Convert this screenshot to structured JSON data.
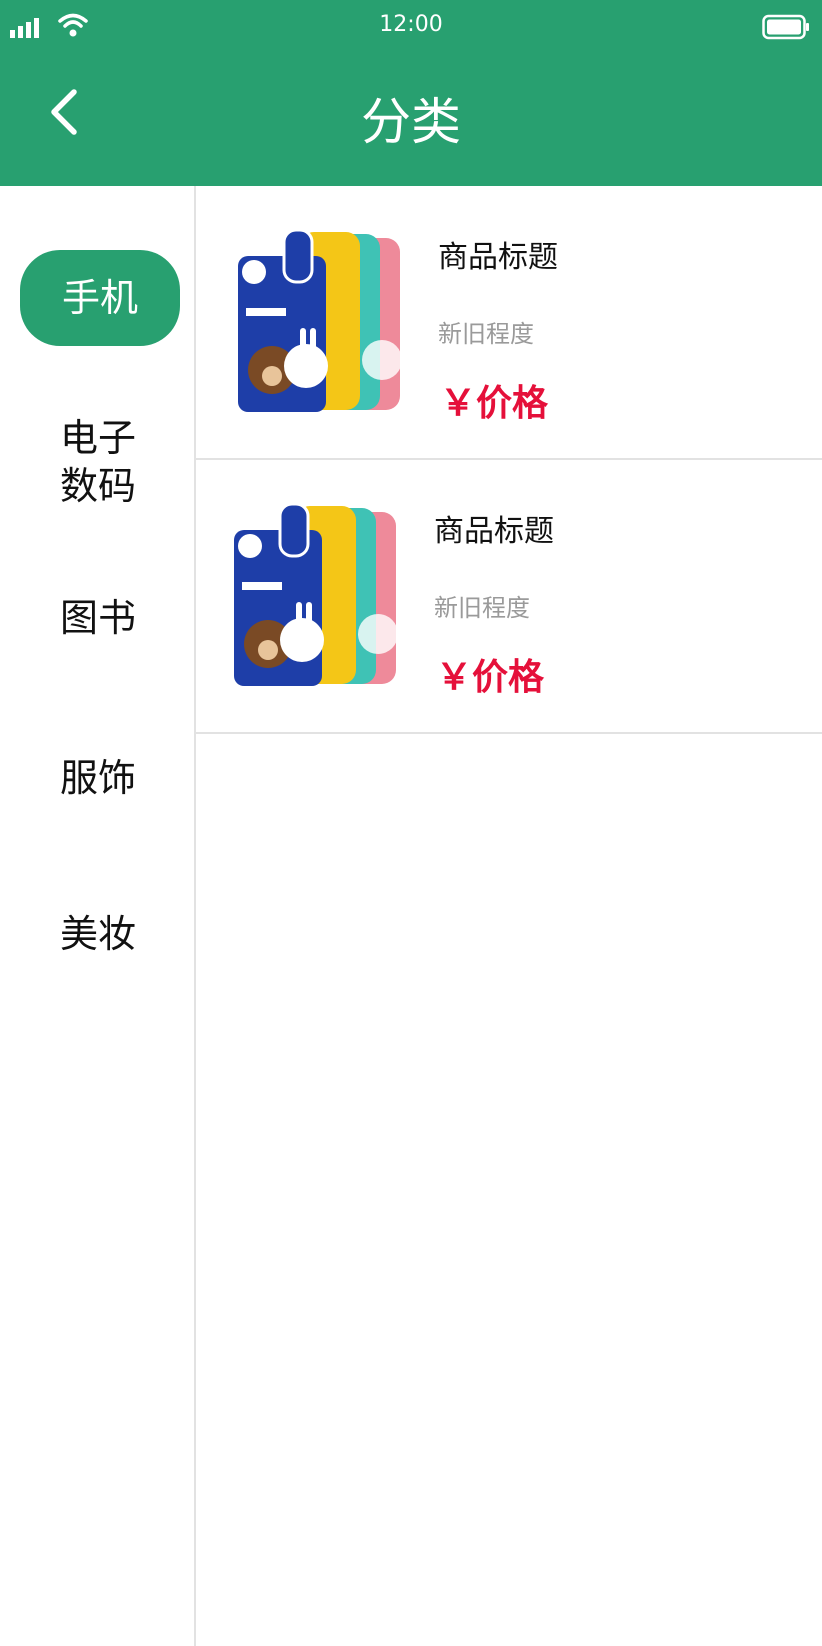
{
  "status_bar": {
    "time": "12:00"
  },
  "header": {
    "title": "分类"
  },
  "sidebar": {
    "items": [
      {
        "label": "手机",
        "active": true
      },
      {
        "label": "电子\n数码"
      },
      {
        "label": "图书"
      },
      {
        "label": "服饰"
      },
      {
        "label": "美妆"
      }
    ]
  },
  "products": [
    {
      "title": "商品标题",
      "condition": "新旧程度",
      "price": "￥价格"
    },
    {
      "title": "商品标题",
      "condition": "新旧程度",
      "price": "￥价格"
    }
  ],
  "colors": {
    "brand": "#28a070",
    "price": "#e5103a"
  }
}
